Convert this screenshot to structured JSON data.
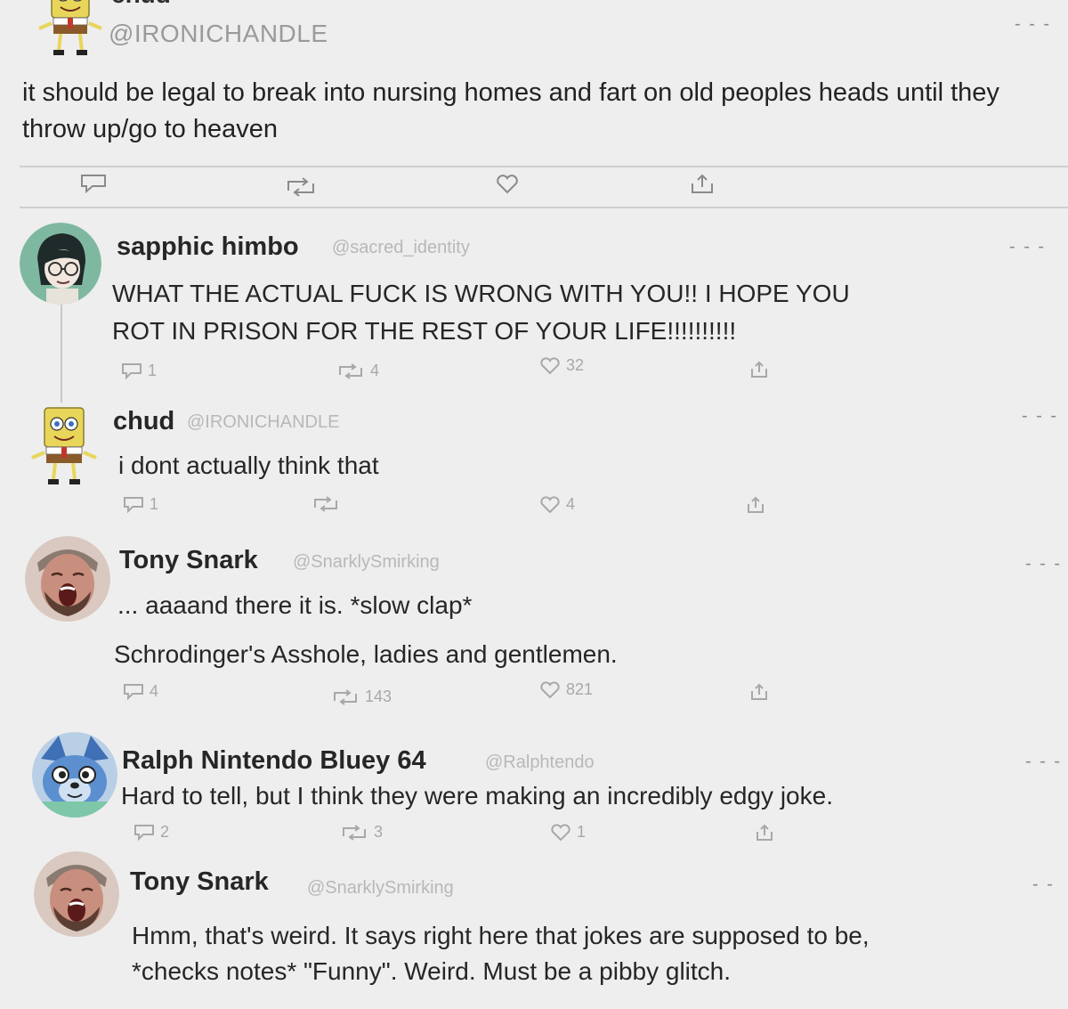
{
  "main_tweet": {
    "name": "chud",
    "handle": "@IRONICHANDLE",
    "text": "it should be legal to break into nursing homes and fart on old peoples heads until they throw up/go to heaven",
    "more": "- - -",
    "avatar_icon": "spongebob-avatar-icon"
  },
  "replies": [
    {
      "name": "sapphic himbo",
      "handle": "@sacred_identity",
      "lines": [
        "WHAT THE ACTUAL FUCK IS WRONG WITH YOU!! I HOPE YOU",
        "ROT IN PRISON FOR THE REST OF YOUR LIFE!!!!!!!!!!"
      ],
      "reply_count": "1",
      "retweet_count": "4",
      "like_count": "32",
      "more": "- - -",
      "avatar_icon": "cartoon-girl-avatar-icon"
    },
    {
      "name": "chud",
      "handle": "@IRONICHANDLE",
      "lines": [
        "i dont actually think that"
      ],
      "reply_count": "1",
      "retweet_count": "",
      "like_count": "4",
      "more": "- - -",
      "avatar_icon": "spongebob-avatar-icon"
    },
    {
      "name": "Tony Snark",
      "handle": "@SnarklySmirking",
      "lines": [
        "... aaaand there it is. *slow clap*",
        "Schrodinger's Asshole, ladies and gentlemen."
      ],
      "reply_count": "4",
      "retweet_count": "143",
      "like_count": "821",
      "more": "- - -",
      "avatar_icon": "laughing-man-avatar-icon"
    },
    {
      "name": "Ralph Nintendo Bluey 64",
      "handle": "@Ralphtendo",
      "lines": [
        "Hard to tell, but I think they were making an incredibly edgy joke."
      ],
      "reply_count": "2",
      "retweet_count": "3",
      "like_count": "1",
      "more": "- - -",
      "avatar_icon": "bluey-avatar-icon"
    },
    {
      "name": "Tony Snark",
      "handle": "@SnarklySmirking",
      "lines": [
        "Hmm, that's weird. It says right here that jokes are supposed to be,",
        "*checks notes* \"Funny\". Weird. Must be a pibby glitch."
      ],
      "more": "- -",
      "avatar_icon": "laughing-man-avatar-icon"
    }
  ]
}
